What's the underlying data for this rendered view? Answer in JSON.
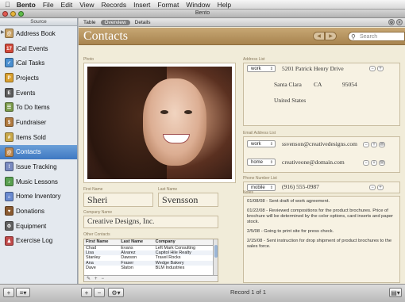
{
  "menubar": {
    "apple": "",
    "app": "Bento",
    "items": [
      "File",
      "Edit",
      "View",
      "Records",
      "Insert",
      "Format",
      "Window",
      "Help"
    ]
  },
  "window": {
    "title": "Bento"
  },
  "sidebar": {
    "header": "Source",
    "items": [
      {
        "label": "Address Book",
        "icon": "address-book-icon",
        "color": "#c8a266",
        "glyph": "@"
      },
      {
        "label": "iCal Events",
        "icon": "calendar-icon",
        "color": "#d24a3b",
        "glyph": "17"
      },
      {
        "label": "iCal Tasks",
        "icon": "tasks-icon",
        "color": "#4a8fd0",
        "glyph": "✓"
      },
      {
        "label": "Projects",
        "icon": "projects-icon",
        "color": "#d9a030",
        "glyph": "P"
      },
      {
        "label": "Events",
        "icon": "events-icon",
        "color": "#5b5b5b",
        "glyph": "E"
      },
      {
        "label": "To Do Items",
        "icon": "todo-icon",
        "color": "#7a9a4a",
        "glyph": "☰"
      },
      {
        "label": "Fundraiser",
        "icon": "fundraiser-icon",
        "color": "#b07a40",
        "glyph": "$"
      },
      {
        "label": "Items Sold",
        "icon": "items-sold-icon",
        "color": "#c9a84a",
        "glyph": "#"
      },
      {
        "label": "Contacts",
        "icon": "contacts-icon",
        "color": "#c08a50",
        "glyph": "@"
      },
      {
        "label": "Issue Tracking",
        "icon": "issue-tracking-icon",
        "color": "#7a8ac0",
        "glyph": "!"
      },
      {
        "label": "Music Lessons",
        "icon": "music-lessons-icon",
        "color": "#5aa050",
        "glyph": "♪"
      },
      {
        "label": "Home Inventory",
        "icon": "home-inventory-icon",
        "color": "#6a8ad0",
        "glyph": "⌂"
      },
      {
        "label": "Donations",
        "icon": "donations-icon",
        "color": "#8a5a30",
        "glyph": "♥"
      },
      {
        "label": "Equipment",
        "icon": "equipment-icon",
        "color": "#606060",
        "glyph": "⚙"
      },
      {
        "label": "Exercise Log",
        "icon": "exercise-log-icon",
        "color": "#c04a4a",
        "glyph": "♟"
      }
    ],
    "selected_index": 8
  },
  "viewbar": {
    "tabs": [
      "Table",
      "Overview",
      "Details"
    ],
    "active_tab": 1
  },
  "header": {
    "title": "Contacts",
    "search_placeholder": "Search"
  },
  "form": {
    "photo_label": "Photo",
    "first_name_label": "First Name",
    "first_name": "Sheri",
    "last_name_label": "Last Name",
    "last_name": "Svensson",
    "company_label": "Company Name",
    "company": "Creative Designs, Inc.",
    "other_contacts_label": "Other Contacts",
    "other_contacts": {
      "columns": [
        "First Name",
        "Last Name",
        "Company"
      ],
      "rows": [
        [
          "Chad",
          "Evans",
          "Left Mark Consulting"
        ],
        [
          "Lisa",
          "Alvarez",
          "Capitol Hile Realty"
        ],
        [
          "Stanley",
          "Dawson",
          "Travel Rocks"
        ],
        [
          "Ana",
          "Fraser",
          "Wedge Bakery"
        ],
        [
          "Dave",
          "Slaton",
          "BLM Industries"
        ]
      ]
    },
    "address_label": "Address List",
    "address": {
      "type": "work",
      "street": "5201 Patrick Henry Drive",
      "city": "Santa Clara",
      "state": "CA",
      "zip": "95054",
      "country": "United States"
    },
    "email_label": "Email Address List",
    "emails": [
      {
        "type": "work",
        "value": "ssvenson@creativedesigns.com"
      },
      {
        "type": "home",
        "value": "creativeone@domain.com"
      }
    ],
    "phone_label": "Phone Number List",
    "phones": [
      {
        "type": "mobile",
        "value": "(916) 555-0987"
      }
    ],
    "notes_label": "Notes",
    "notes": [
      "01/08/08 - Sent draft of work agreement.",
      "01/22/08 - Reviewed compositions for the product brochures. Price of brochure will be determined by the color options, card inserts and paper stock.",
      "2/5/08 - Going to print site for press check.",
      "2/15/08 - Sent instruction for drop shipment of product brochures to the sales force."
    ]
  },
  "bottom": {
    "record_text": "Record 1 of 1"
  }
}
